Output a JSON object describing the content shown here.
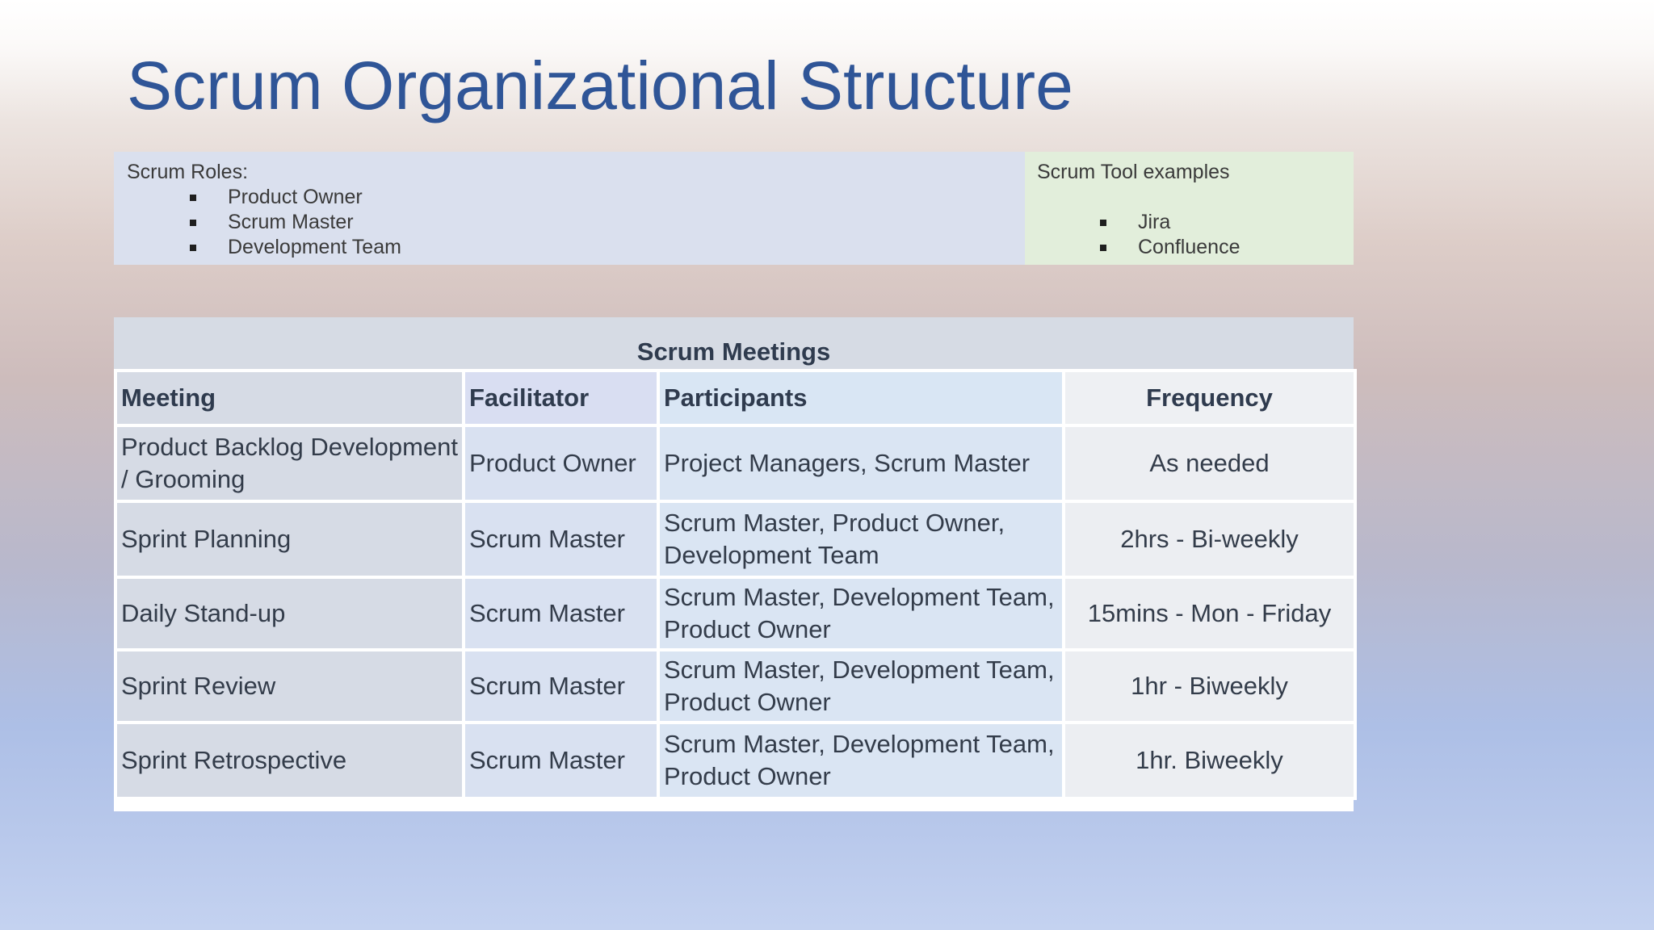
{
  "title": "Scrum Organizational Structure",
  "roles": {
    "heading": "Scrum Roles:",
    "items": [
      "Product Owner",
      "Scrum Master",
      "Development Team"
    ]
  },
  "tools": {
    "heading": "Scrum Tool examples",
    "items": [
      "Jira",
      "Confluence"
    ]
  },
  "meetings": {
    "caption": "Scrum Meetings",
    "headers": [
      "Meeting",
      "Facilitator",
      "Participants",
      "Frequency"
    ],
    "rows": [
      [
        "Product Backlog Development / Grooming",
        "Product Owner",
        "Project Managers, Scrum Master",
        "As needed"
      ],
      [
        "Sprint Planning",
        "Scrum Master",
        "Scrum Master, Product Owner, Development Team",
        "2hrs - Bi-weekly"
      ],
      [
        "Daily Stand-up",
        "Scrum Master",
        "Scrum Master, Development Team, Product Owner",
        "15mins - Mon - Friday"
      ],
      [
        "Sprint Review",
        "Scrum Master",
        "Scrum Master, Development Team, Product Owner",
        "1hr - Biweekly"
      ],
      [
        "Sprint Retrospective",
        "Scrum Master",
        "Scrum Master, Development Team, Product Owner",
        "1hr. Biweekly"
      ]
    ]
  }
}
